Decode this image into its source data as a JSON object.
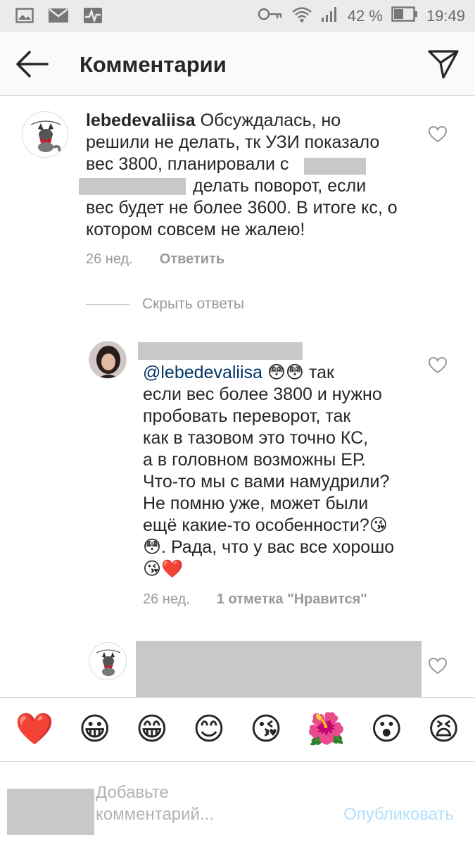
{
  "status_bar": {
    "battery_percent": "42 %",
    "time": "19:49"
  },
  "header": {
    "title": "Комментарии"
  },
  "comments": [
    {
      "username": "lebedevaliisa",
      "text_lines": [
        "Обсуждалась, но",
        "решили не делать, тк УЗИ показало",
        "вес 3800, планировали с",
        "делать поворот, если",
        "вес будет не более 3600. В итоге кс, о",
        "котором совсем не жалею!"
      ],
      "time": "26 нед.",
      "reply_label": "Ответить"
    }
  ],
  "hide_replies_label": "Скрыть ответы",
  "reply": {
    "mention": "@lebedevaliisa",
    "emoji_after_mention": "😳😳",
    "text_lines": [
      "так",
      "если вес более 3800 и нужно",
      "пробовать переворот, так",
      "как в тазовом это точно КС,",
      "а в головном возможны ЕР.",
      "Что-то мы с вами намудрили?",
      "Не помню уже, может были",
      "ещё какие-то особенности?😘",
      "😳. Рада, что у вас все хорошо",
      "😘❤️"
    ],
    "time": "26 нед.",
    "likes_label": "1 отметка \"Нравится\""
  },
  "emoji_bar": [
    "❤️",
    "😀",
    "😁",
    "😊",
    "😘",
    "🌺",
    "😮",
    "😫"
  ],
  "compose": {
    "placeholder_line1": "Добавьте",
    "placeholder_line2": "комментарий...",
    "publish_label": "Опубликовать"
  },
  "colors": {
    "status_bar_bg": "#ebebeb",
    "header_bg": "#fafafa",
    "text": "#262626",
    "meta": "#999999",
    "mention": "#003569",
    "publish": "#b2dffc",
    "redaction": "#c8c8c8"
  },
  "icons": {
    "back": "arrow-left-icon",
    "send": "paper-plane-icon",
    "like": "heart-outline-icon"
  }
}
